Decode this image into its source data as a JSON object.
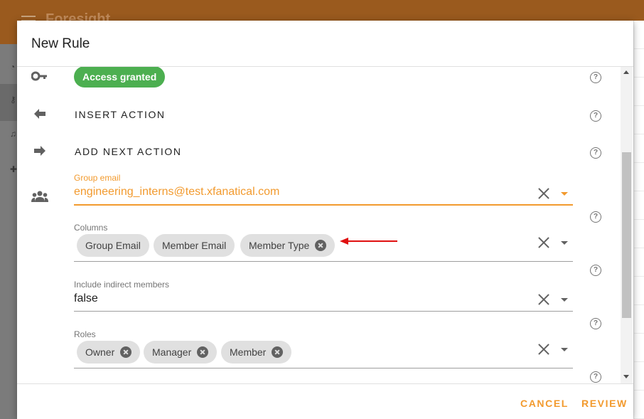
{
  "app": {
    "title": "Foresight"
  },
  "dialog": {
    "title": "New Rule",
    "badge": "Access granted",
    "insert_action": "INSERT ACTION",
    "add_next_action": "ADD NEXT ACTION",
    "help_glyph": "?",
    "fields": {
      "group_email": {
        "label": "Group email",
        "value": "engineering_interns@test.xfanatical.com"
      },
      "columns": {
        "label": "Columns",
        "chips": [
          "Group Email",
          "Member Email",
          "Member Type"
        ]
      },
      "indirect": {
        "label": "Include indirect members",
        "value": "false"
      },
      "roles": {
        "label": "Roles",
        "chips": [
          "Owner",
          "Manager",
          "Member"
        ]
      }
    },
    "footer": {
      "cancel": "CANCEL",
      "review": "REVIEW"
    }
  },
  "colors": {
    "accent": "#f29a2e",
    "badge": "#4caf50",
    "app_bar": "#9a5a1e",
    "annotation_arrow": "#e01010"
  },
  "icons": [
    "menu-icon",
    "key-icon",
    "arrow-left-icon",
    "arrow-right-icon",
    "group-icon",
    "help-icon",
    "close-icon",
    "dropdown-icon",
    "chip-remove-icon"
  ]
}
